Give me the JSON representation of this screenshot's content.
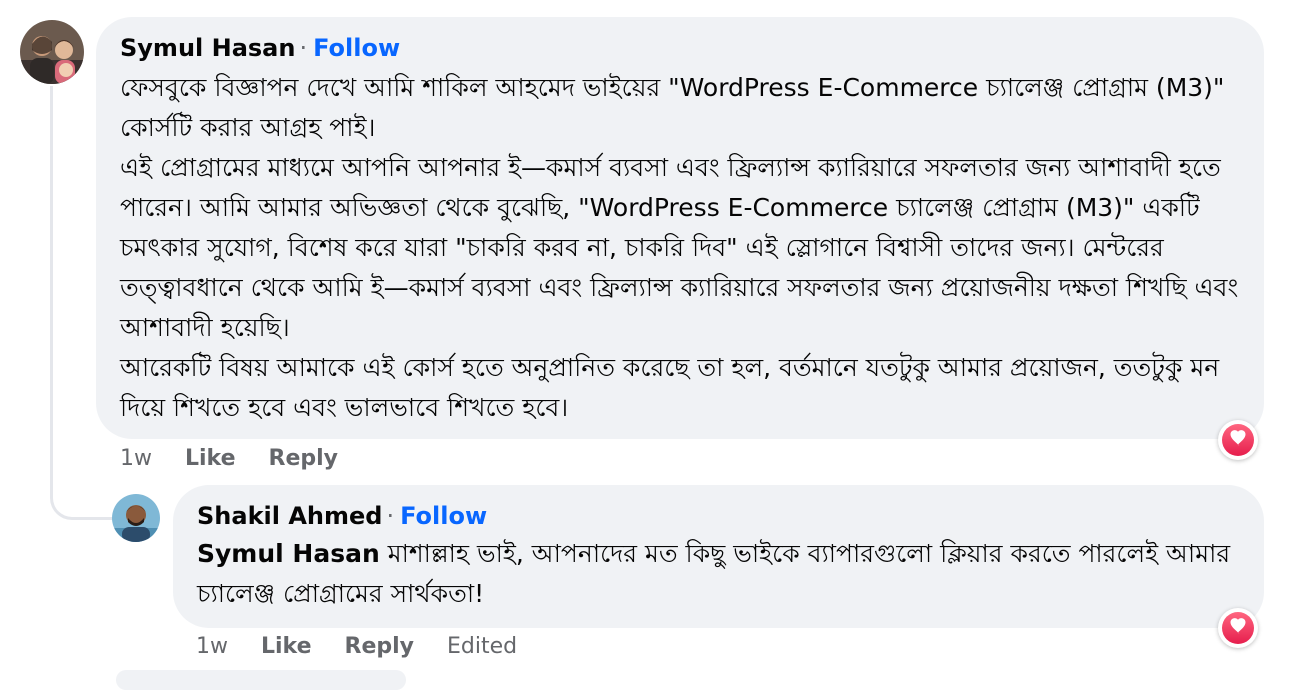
{
  "comments": [
    {
      "author": "Symul Hasan",
      "separator": "·",
      "follow_label": "Follow",
      "body": "ফেসবুকে বিজ্ঞাপন দেখে আমি শাকিল আহমেদ ভাইয়ের \"WordPress E-Commerce চ্যালেঞ্জ প্রোগ্রাম (M3)\" কোর্সটি করার আগ্রহ পাই।\nএই প্রোগ্রামের মাধ্যমে আপনি আপনার ই—কমার্স ব্যবসা এবং ফ্রিল্যান্স ক্যারিয়ারে সফলতার জন্য আশাবাদী হতে পারেন। আমি আমার অভিজ্ঞতা থেকে বুঝেছি, \"WordPress E-Commerce চ্যালেঞ্জ প্রোগ্রাম (M3)\" একটি চমৎকার সুযোগ, বিশেষ করে যারা \"চাকরি করব না, চাকরি দিব\" এই স্লোগানে বিশ্বাসী তাদের জন্য। মেন্টরের তত্ত্বাবধানে থেকে আমি ই—কমার্স ব্যবসা এবং ফ্রিল্যান্স ক্যারিয়ারে সফলতার জন্য প্রয়োজনীয় দক্ষতা শিখছি এবং আশাবাদী হয়েছি।\nআরেকটি বিষয় আমাকে এই কোর্স হতে অনুপ্রানিত করেছে তা হল, বর্তমানে যতটুকু আমার প্রয়োজন, ততটুকু মন দিয়ে শিখতে হবে এবং ভালভাবে শিখতে হবে।",
      "time": "1w",
      "like_label": "Like",
      "reply_label": "Reply",
      "reaction": "love"
    },
    {
      "author": "Shakil Ahmed",
      "separator": "·",
      "follow_label": "Follow",
      "mention": "Symul Hasan",
      "body": " মাশাল্লাহ ভাই, আপনাদের মত কিছু ভাইকে ব্যাপারগুলো ক্লিয়ার করতে পারলেই আমার চ্যালেঞ্জ প্রোগ্রামের সার্থকতা!",
      "time": "1w",
      "like_label": "Like",
      "reply_label": "Reply",
      "edited_label": "Edited",
      "reaction": "love"
    }
  ],
  "colors": {
    "bubble": "#f0f2f5",
    "follow": "#0866ff",
    "meta": "#65676b",
    "love": "#f33e58"
  },
  "icons": {
    "reaction": "heart-icon"
  }
}
